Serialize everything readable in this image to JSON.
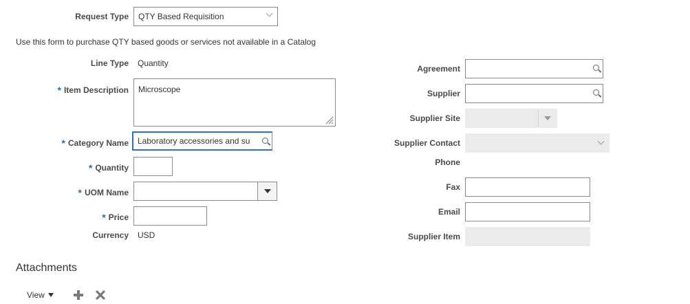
{
  "request_type": {
    "label": "Request Type",
    "value": "QTY Based Requisition"
  },
  "intro_text": "Use this form to purchase QTY based goods or services not available in a Catalog",
  "left": {
    "line_type": {
      "label": "Line Type",
      "value": "Quantity"
    },
    "item_description": {
      "label": "Item Description",
      "value": "Microscope"
    },
    "category_name": {
      "label": "Category Name",
      "value": "Laboratory accessories and su"
    },
    "quantity": {
      "label": "Quantity",
      "value": ""
    },
    "uom_name": {
      "label": "UOM Name",
      "value": ""
    },
    "price": {
      "label": "Price",
      "value": ""
    },
    "currency": {
      "label": "Currency",
      "value": "USD"
    }
  },
  "right": {
    "agreement": {
      "label": "Agreement",
      "value": ""
    },
    "supplier": {
      "label": "Supplier",
      "value": ""
    },
    "supplier_site": {
      "label": "Supplier Site",
      "value": ""
    },
    "supplier_contact": {
      "label": "Supplier Contact",
      "value": ""
    },
    "phone": {
      "label": "Phone",
      "value": ""
    },
    "fax": {
      "label": "Fax",
      "value": ""
    },
    "email": {
      "label": "Email",
      "value": ""
    },
    "supplier_item": {
      "label": "Supplier Item",
      "value": ""
    }
  },
  "attachments": {
    "title": "Attachments",
    "view_label": "View"
  },
  "required_marker": "*",
  "icons": {
    "search": "search-icon",
    "dropdown": "dropdown-arrow-icon",
    "add": "add-icon",
    "delete": "delete-icon"
  },
  "colors": {
    "required": "#1f6fb5",
    "focus_border": "#2c6ecb",
    "disabled_bg": "#ebebeb"
  }
}
